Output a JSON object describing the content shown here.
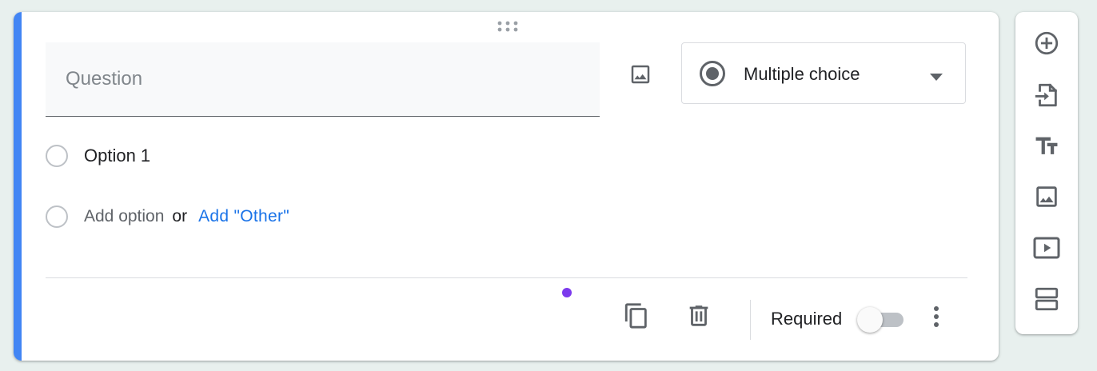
{
  "question": {
    "placeholder": "Question",
    "value": ""
  },
  "question_type": {
    "label": "Multiple choice",
    "icon": "radio-button-checked-icon"
  },
  "options": [
    {
      "label": "Option 1"
    }
  ],
  "add_option": {
    "label": "Add option",
    "or": "or",
    "add_other": "Add \"Other\""
  },
  "footer": {
    "duplicate_icon": "content-copy-icon",
    "delete_icon": "trash-icon",
    "required_label": "Required",
    "required": false,
    "more_icon": "more-vertical-icon"
  },
  "side_toolbar": {
    "items": [
      {
        "icon": "add-circle-icon"
      },
      {
        "icon": "import-questions-icon"
      },
      {
        "icon": "title-text-icon"
      },
      {
        "icon": "image-icon"
      },
      {
        "icon": "video-icon"
      },
      {
        "icon": "section-icon"
      }
    ]
  },
  "colors": {
    "accent": "#4285f4",
    "link": "#1a73e8",
    "indicator_dot": "#7c3aed",
    "icon": "#5f6368"
  }
}
